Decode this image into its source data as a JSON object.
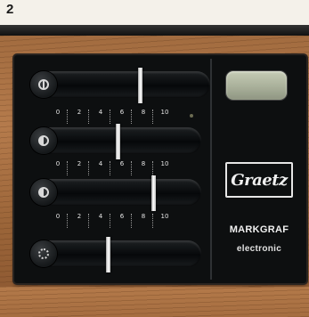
{
  "figure_label": "2",
  "scale_ticks": [
    "0",
    "2",
    "4",
    "6",
    "8",
    "10"
  ],
  "sliders": [
    {
      "id": "volume",
      "icon": "volume-icon",
      "level": 0.62
    },
    {
      "id": "balance",
      "icon": "balance-icon",
      "level": 0.45
    },
    {
      "id": "tone",
      "icon": "tone-icon",
      "level": 0.72
    },
    {
      "id": "brightness",
      "icon": "brightness-icon",
      "level": 0.38
    }
  ],
  "logo": "Graetz",
  "brand": "MARKGRAF",
  "subtitle": "electronic",
  "colors": {
    "panel": "#0d0f10",
    "wood": "#a06a3e",
    "display": "#b7bda6",
    "labels": "#f0f0f0"
  }
}
